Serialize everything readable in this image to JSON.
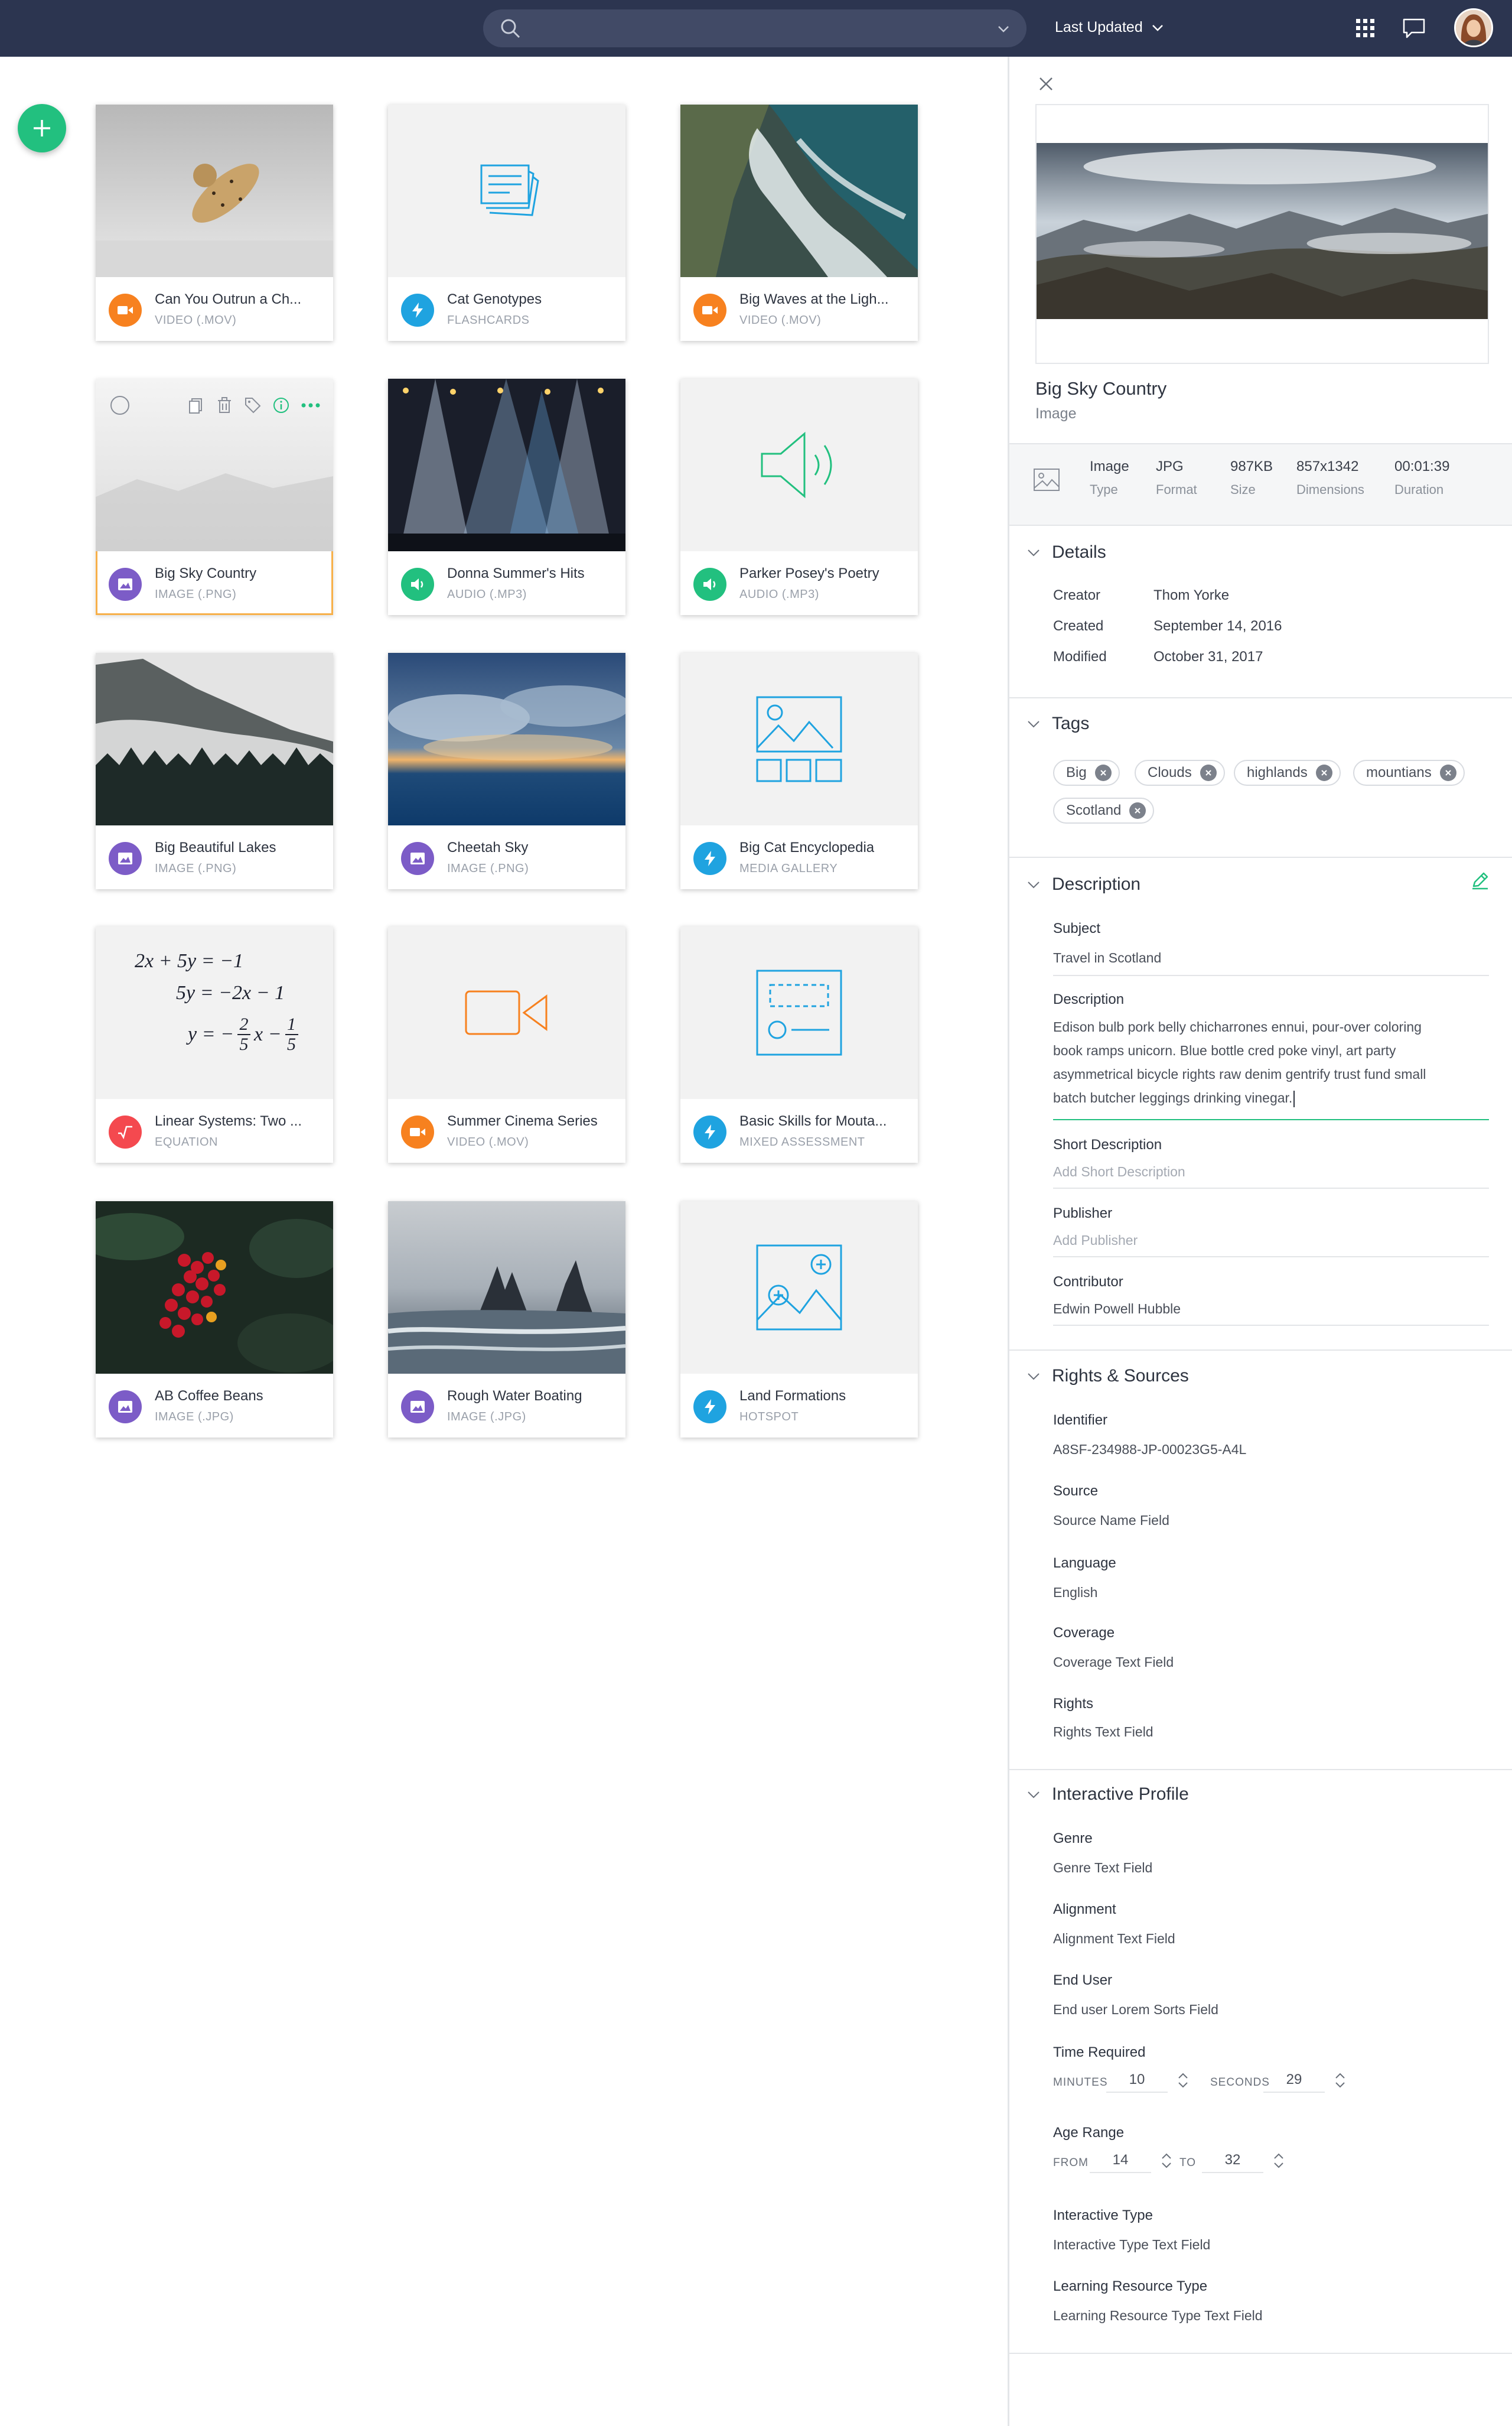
{
  "header": {
    "search_placeholder": "",
    "sort_label": "Last Updated"
  },
  "cards": [
    {
      "title": "Can You Outrun a Ch...",
      "subtitle": "VIDEO (.MOV)",
      "type": "video",
      "badge_color": "#f7811f"
    },
    {
      "title": "Cat Genotypes",
      "subtitle": "FLASHCARDS",
      "type": "flashcards",
      "badge_color": "#1fa3e0"
    },
    {
      "title": "Big Waves at the Ligh...",
      "subtitle": "VIDEO (.MOV)",
      "type": "video",
      "badge_color": "#f7811f"
    },
    {
      "title": "Big Sky Country",
      "subtitle": "IMAGE (.PNG)",
      "type": "image",
      "badge_color": "#7c5cc7"
    },
    {
      "title": "Donna Summer's Hits",
      "subtitle": "AUDIO (.MP3)",
      "type": "audio",
      "badge_color": "#22c07f"
    },
    {
      "title": "Parker Posey's Poetry",
      "subtitle": "AUDIO (.MP3)",
      "type": "audio",
      "badge_color": "#22c07f"
    },
    {
      "title": "Big Beautiful Lakes",
      "subtitle": "IMAGE (.PNG)",
      "type": "image",
      "badge_color": "#7c5cc7"
    },
    {
      "title": "Cheetah Sky",
      "subtitle": "IMAGE (.PNG)",
      "type": "image",
      "badge_color": "#7c5cc7"
    },
    {
      "title": "Big Cat Encyclopedia",
      "subtitle": "MEDIA GALLERY",
      "type": "gallery",
      "badge_color": "#1fa3e0"
    },
    {
      "title": "Linear Systems: Two ...",
      "subtitle": "EQUATION",
      "type": "equation",
      "badge_color": "#f4494f"
    },
    {
      "title": "Summer Cinema Series",
      "subtitle": "VIDEO (.MOV)",
      "type": "video",
      "badge_color": "#f7811f"
    },
    {
      "title": "Basic Skills for Mouta...",
      "subtitle": "MIXED ASSESSMENT",
      "type": "assessment",
      "badge_color": "#1fa3e0"
    },
    {
      "title": "AB Coffee Beans",
      "subtitle": "IMAGE (.JPG)",
      "type": "image",
      "badge_color": "#7c5cc7"
    },
    {
      "title": "Rough Water Boating",
      "subtitle": "IMAGE (.JPG)",
      "type": "image",
      "badge_color": "#7c5cc7"
    },
    {
      "title": "Land Formations",
      "subtitle": "HOTSPOT",
      "type": "hotspot",
      "badge_color": "#1fa3e0"
    }
  ],
  "equation": {
    "line1": "2x + 5y = −1",
    "line2": "5y = −2x − 1",
    "line3_lhs": "y = −",
    "frac1_num": "2",
    "frac1_den": "5",
    "line3_mid": "x −",
    "frac2_num": "1",
    "frac2_den": "5"
  },
  "panel": {
    "title": "Big Sky Country",
    "kind": "Image",
    "meta": [
      {
        "value": "Image",
        "label": "Type"
      },
      {
        "value": "JPG",
        "label": "Format"
      },
      {
        "value": "987KB",
        "label": "Size"
      },
      {
        "value": "857x1342",
        "label": "Dimensions"
      },
      {
        "value": "00:01:39",
        "label": "Duration"
      }
    ],
    "details": {
      "heading": "Details",
      "rows": [
        {
          "label": "Creator",
          "value": "Thom Yorke"
        },
        {
          "label": "Created",
          "value": "September 14, 2016"
        },
        {
          "label": "Modified",
          "value": "October 31, 2017"
        }
      ]
    },
    "tags": {
      "heading": "Tags",
      "items": [
        "Big",
        "Clouds",
        "highlands",
        "mountians",
        "Scotland"
      ]
    },
    "description": {
      "heading": "Description",
      "subject_label": "Subject",
      "subject_value": "Travel in Scotland",
      "desc_label": "Description",
      "desc_lines": [
        "Edison bulb pork belly chicharrones ennui, pour-over coloring",
        "book ramps unicorn. Blue bottle cred poke vinyl, art party",
        "asymmetrical bicycle rights raw denim gentrify trust fund small",
        "batch butcher leggings drinking vinegar."
      ],
      "short_label": "Short Description",
      "short_placeholder": "Add Short Description",
      "publisher_label": "Publisher",
      "publisher_placeholder": "Add Publisher",
      "contributor_label": "Contributor",
      "contributor_value": "Edwin Powell Hubble"
    },
    "rights": {
      "heading": "Rights & Sources",
      "fields": [
        {
          "label": "Identifier",
          "value": "A8SF-234988-JP-00023G5-A4L"
        },
        {
          "label": "Source",
          "value": "Source Name Field"
        },
        {
          "label": "Language",
          "value": "English"
        },
        {
          "label": "Coverage",
          "value": "Coverage Text Field"
        },
        {
          "label": "Rights",
          "value": "Rights Text Field"
        }
      ]
    },
    "profile": {
      "heading": "Interactive Profile",
      "genre_label": "Genre",
      "genre_value": "Genre Text Field",
      "alignment_label": "Alignment",
      "alignment_value": "Alignment Text Field",
      "enduser_label": "End User",
      "enduser_value": "End user Lorem  Sorts Field",
      "time_label": "Time Required",
      "minutes_label": "MINUTES",
      "minutes_value": "10",
      "seconds_label": "SECONDS",
      "seconds_value": "29",
      "age_label": "Age Range",
      "from_label": "FROM",
      "from_value": "14",
      "to_label": "TO",
      "to_value": "32",
      "itype_label": "Interactive Type",
      "itype_value": "Interactive Type Text Field",
      "lrt_label": "Learning Resource Type",
      "lrt_value": "Learning Resource Type Text Field"
    }
  },
  "colors": {
    "topbar": "#2c3550",
    "accent_green": "#22c07f",
    "selected_border": "#f7b04a",
    "video": "#f7811f",
    "interactive": "#1fa3e0",
    "image": "#7c5cc7",
    "audio": "#22c07f",
    "equation": "#f4494f"
  }
}
